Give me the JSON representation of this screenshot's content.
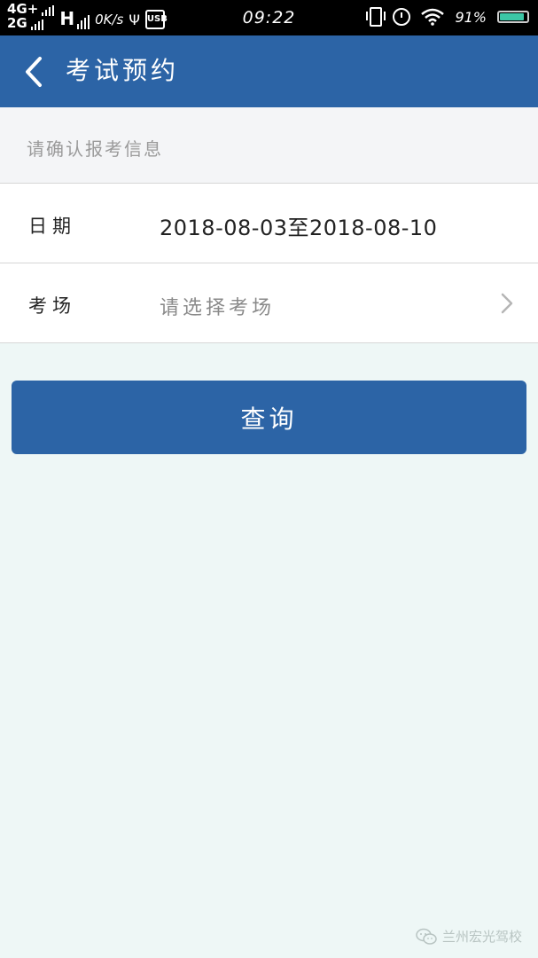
{
  "status_bar": {
    "network_top": "4G+",
    "network_bottom": "2G",
    "network_h": "H",
    "speed": "0K/s",
    "time": "09:22",
    "battery_percent": "91%",
    "battery_level": 0.91,
    "battery_color": "#3cc6a6"
  },
  "navbar": {
    "title": "考试预约",
    "background_color": "#2c64a6"
  },
  "form": {
    "hint": "请确认报考信息",
    "date_label": "日期",
    "date_value": "2018-08-03至2018-08-10",
    "venue_label": "考场",
    "venue_placeholder": "请选择考场"
  },
  "actions": {
    "query_label": "查询"
  },
  "watermark": {
    "text": "兰州宏光驾校"
  },
  "icons": {
    "back": "chevron-left-icon",
    "venue_arrow": "chevron-right-icon",
    "wifi": "wifi-icon",
    "alarm": "alarm-icon",
    "vibrate": "vibrate-icon",
    "usb": "usb-icon",
    "battery": "battery-icon",
    "wechat": "wechat-icon"
  }
}
